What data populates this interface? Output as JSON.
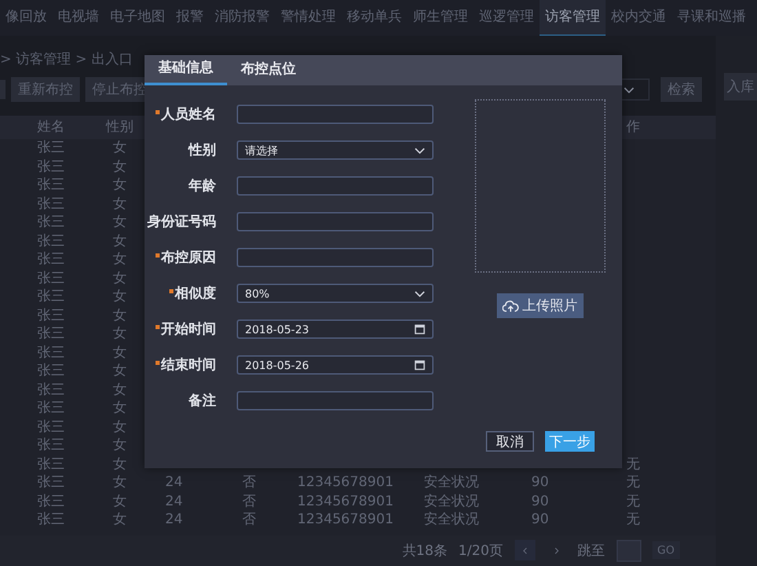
{
  "nav": [
    {
      "label": "像回放",
      "selected": false
    },
    {
      "label": "电视墙",
      "selected": false
    },
    {
      "label": "电子地图",
      "selected": false
    },
    {
      "label": "报警",
      "selected": false
    },
    {
      "label": "消防报警",
      "selected": false
    },
    {
      "label": "警情处理",
      "selected": false
    },
    {
      "label": "移动单兵",
      "selected": false
    },
    {
      "label": "师生管理",
      "selected": false
    },
    {
      "label": "巡逻管理",
      "selected": false
    },
    {
      "label": "访客管理",
      "selected": true
    },
    {
      "label": "校内交通",
      "selected": false
    },
    {
      "label": "寻课和巡播",
      "selected": false
    }
  ],
  "breadcrumb": "> 访客管理 > 出入口",
  "toolbar": {
    "buttons": [
      "重新布控",
      "停止布控"
    ],
    "search_button": "检索",
    "side_button": "入库"
  },
  "table": {
    "columns": [
      "姓名",
      "性别",
      "",
      "",
      "",
      "",
      "",
      "作"
    ],
    "rows": [
      {
        "cells": [
          "张三",
          "女"
        ]
      },
      {
        "cells": [
          "张三",
          "女"
        ]
      },
      {
        "cells": [
          "张三",
          "女"
        ]
      },
      {
        "cells": [
          "张三",
          "女"
        ]
      },
      {
        "cells": [
          "张三",
          "女"
        ]
      },
      {
        "cells": [
          "张三",
          "女"
        ]
      },
      {
        "cells": [
          "张三",
          "女"
        ]
      },
      {
        "cells": [
          "张三",
          "女"
        ]
      },
      {
        "cells": [
          "张三",
          "女"
        ]
      },
      {
        "cells": [
          "张三",
          "女"
        ]
      },
      {
        "cells": [
          "张三",
          "女"
        ]
      },
      {
        "cells": [
          "张三",
          "女"
        ]
      },
      {
        "cells": [
          "张三",
          "女"
        ]
      },
      {
        "cells": [
          "张三",
          "女"
        ]
      },
      {
        "cells": [
          "张三",
          "女"
        ]
      },
      {
        "cells": [
          "张三",
          "女"
        ]
      },
      {
        "cells": [
          "张三",
          "女"
        ]
      },
      {
        "cells": [
          "张三",
          "女",
          "",
          "",
          "",
          "",
          "",
          "无"
        ]
      },
      {
        "cells": [
          "张三",
          "女",
          "24",
          "否",
          "12345678901",
          "安全状况",
          "90",
          "无"
        ]
      },
      {
        "cells": [
          "张三",
          "女",
          "24",
          "否",
          "12345678901",
          "安全状况",
          "90",
          "无"
        ]
      },
      {
        "cells": [
          "张三",
          "女",
          "24",
          "否",
          "12345678901",
          "安全状况",
          "90",
          "无"
        ]
      }
    ]
  },
  "pagination": {
    "total": "共18条",
    "page": "1/20页",
    "jump_label": "跳至",
    "go": "GO"
  },
  "modal": {
    "tabs": [
      {
        "label": "基础信息",
        "selected": true
      },
      {
        "label": "布控点位",
        "selected": false
      }
    ],
    "fields": [
      {
        "label": "人员姓名",
        "required": true,
        "kind": "text"
      },
      {
        "label": "性别",
        "required": false,
        "kind": "select",
        "value": "请选择"
      },
      {
        "label": "年龄",
        "required": false,
        "kind": "text"
      },
      {
        "label": "身份证号码",
        "required": false,
        "kind": "text"
      },
      {
        "label": "布控原因",
        "required": true,
        "kind": "text"
      },
      {
        "label": "相似度",
        "required": true,
        "kind": "select",
        "value": "80%"
      },
      {
        "label": "开始时间",
        "required": true,
        "kind": "date",
        "value": "2018-05-23"
      },
      {
        "label": "结束时间",
        "required": true,
        "kind": "date",
        "value": "2018-05-26"
      },
      {
        "label": "备注",
        "required": false,
        "kind": "text"
      }
    ],
    "upload_button": "上传照片",
    "cancel": "取消",
    "next": "下一步"
  }
}
